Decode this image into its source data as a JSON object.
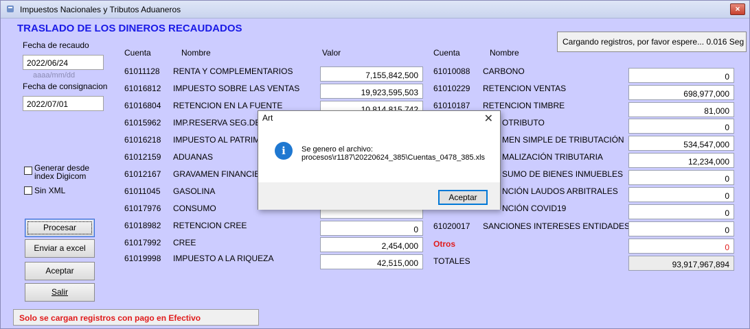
{
  "window": {
    "title": "Impuestos Nacionales y Tributos Aduaneros",
    "close_label": "×"
  },
  "form": {
    "title": "TRASLADO DE LOS DINEROS RECAUDADOS",
    "fecha_recaudo_label": "Fecha de recaudo",
    "fecha_recaudo_value": "2022/06/24",
    "date_format_hint": "aaaa/mm/dd",
    "fecha_consignacion_label": "Fecha de consignacion",
    "fecha_consignacion_value": "2022/07/01",
    "generar_label_1": "Generar desde",
    "generar_label_2": "index Digicom",
    "sin_xml_label": "Sin XML"
  },
  "buttons": {
    "procesar": "Procesar",
    "enviar_excel": "Enviar a excel",
    "aceptar": "Aceptar",
    "salir": "Salir"
  },
  "headers": {
    "cuenta": "Cuenta",
    "nombre": "Nombre",
    "valor": "Valor",
    "cuenta2": "Cuenta",
    "nombre2": "Nombre"
  },
  "left_rows": [
    {
      "cuenta": "61011128",
      "nombre": "RENTA Y COMPLEMENTARIOS",
      "valor": "7,155,842,500"
    },
    {
      "cuenta": "61016812",
      "nombre": "IMPUESTO SOBRE LAS VENTAS",
      "valor": "19,923,595,503"
    },
    {
      "cuenta": "61016804",
      "nombre": "RETENCION EN LA FUENTE",
      "valor": "10,814,815,742"
    },
    {
      "cuenta": "61015962",
      "nombre": "IMP.RESERVA SEG.DEI",
      "valor": ""
    },
    {
      "cuenta": "61016218",
      "nombre": "IMPUESTO AL PATRIMO",
      "valor": ""
    },
    {
      "cuenta": "61012159",
      "nombre": "ADUANAS",
      "valor": ""
    },
    {
      "cuenta": "61012167",
      "nombre": "GRAVAMEN FINANCIEF",
      "valor": ""
    },
    {
      "cuenta": "61011045",
      "nombre": "GASOLINA",
      "valor": ""
    },
    {
      "cuenta": "61017976",
      "nombre": "CONSUMO",
      "valor": ""
    },
    {
      "cuenta": "61018982",
      "nombre": "RETENCION CREE",
      "valor": "0"
    },
    {
      "cuenta": "61017992",
      "nombre": "CREE",
      "valor": "2,454,000"
    },
    {
      "cuenta": "61019998",
      "nombre": "IMPUESTO A LA RIQUEZA",
      "valor": "42,515,000"
    }
  ],
  "right_rows": [
    {
      "cuenta": "61010088",
      "nombre": "CARBONO",
      "valor": "0"
    },
    {
      "cuenta": "61010229",
      "nombre": "RETENCION VENTAS",
      "valor": "698,977,000"
    },
    {
      "cuenta": "61010187",
      "nombre": "RETENCION TIMBRE",
      "valor": "81,000"
    },
    {
      "cuenta": "",
      "nombre": "OTRIBUTO",
      "valor": "0"
    },
    {
      "cuenta": "",
      "nombre": "MEN SIMPLE DE TRIBUTACIÓN",
      "valor": "534,547,000"
    },
    {
      "cuenta": "",
      "nombre": "MALIZACIÓN TRIBUTARIA",
      "valor": "12,234,000"
    },
    {
      "cuenta": "",
      "nombre": "SUMO DE BIENES INMUEBLES",
      "valor": "0"
    },
    {
      "cuenta": "",
      "nombre": "NCIÓN LAUDOS ARBITRALES",
      "valor": "0"
    },
    {
      "cuenta": "",
      "nombre": "NCIÓN COVID19",
      "valor": "0"
    },
    {
      "cuenta": "61020017",
      "nombre": "SANCIONES INTERESES ENTIDADES",
      "valor": "0"
    }
  ],
  "otros": {
    "label": "Otros",
    "valor": "0"
  },
  "totales": {
    "label": "TOTALES",
    "valor": "93,917,967,894"
  },
  "status": {
    "text": "Cargando registros, por favor espere... 0.016 Seg"
  },
  "footer": {
    "text": "Solo se cargan registros con pago en Efectivo"
  },
  "dialog": {
    "title": "Art",
    "close": "✕",
    "icon": "info-icon",
    "message_line1": "Se genero el archivo:",
    "message_line2": "procesos\\r1187\\20220624_385\\Cuentas_0478_385.xls",
    "button": "Aceptar"
  },
  "colors": {
    "background": "#ccccff",
    "title_blue": "#1a1ae6",
    "alert_red": "#e01b1b"
  }
}
